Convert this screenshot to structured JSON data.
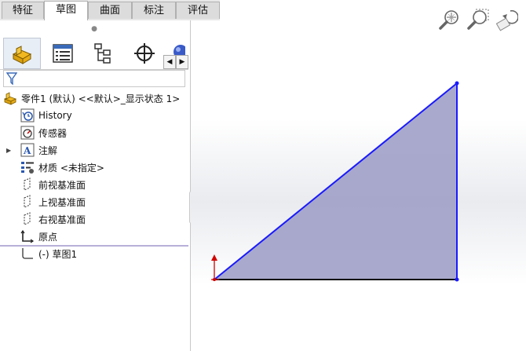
{
  "tabs": [
    {
      "label": "特征",
      "active": false
    },
    {
      "label": "草图",
      "active": true
    },
    {
      "label": "曲面",
      "active": false
    },
    {
      "label": "标注",
      "active": false
    },
    {
      "label": "评估",
      "active": false
    }
  ],
  "panel": {
    "grip_glyph": "●",
    "toolbar": [
      "feature-manager-icon",
      "property-manager-icon",
      "configuration-manager-icon",
      "dimxpert-manager-icon",
      "appearance-icon"
    ],
    "scroll_left": "◀",
    "scroll_right": "▶",
    "filter_icon": "filter-icon"
  },
  "tree": {
    "root": "零件1 (默认) <<默认>_显示状态 1>",
    "items": [
      {
        "label": "History",
        "icon": "history-icon"
      },
      {
        "label": "传感器",
        "icon": "sensor-icon"
      },
      {
        "label": "注解",
        "icon": "annotation-icon",
        "expandable": true
      },
      {
        "label": "材质 <未指定>",
        "icon": "material-icon"
      },
      {
        "label": "前视基准面",
        "icon": "plane-icon"
      },
      {
        "label": "上视基准面",
        "icon": "plane-icon"
      },
      {
        "label": "右视基准面",
        "icon": "plane-icon"
      },
      {
        "label": "原点",
        "icon": "origin-icon"
      },
      {
        "label": "(-) 草图1",
        "icon": "sketch-icon"
      }
    ],
    "expander_glyph": "▶"
  },
  "view_tools": [
    "zoom-to-fit-icon",
    "zoom-to-area-icon",
    "previous-view-icon"
  ],
  "colors": {
    "sketch_line": "#1a1aff",
    "sketch_fill": "#a0a0c8",
    "origin": "#d00000",
    "tab_active": "#ffffff"
  }
}
